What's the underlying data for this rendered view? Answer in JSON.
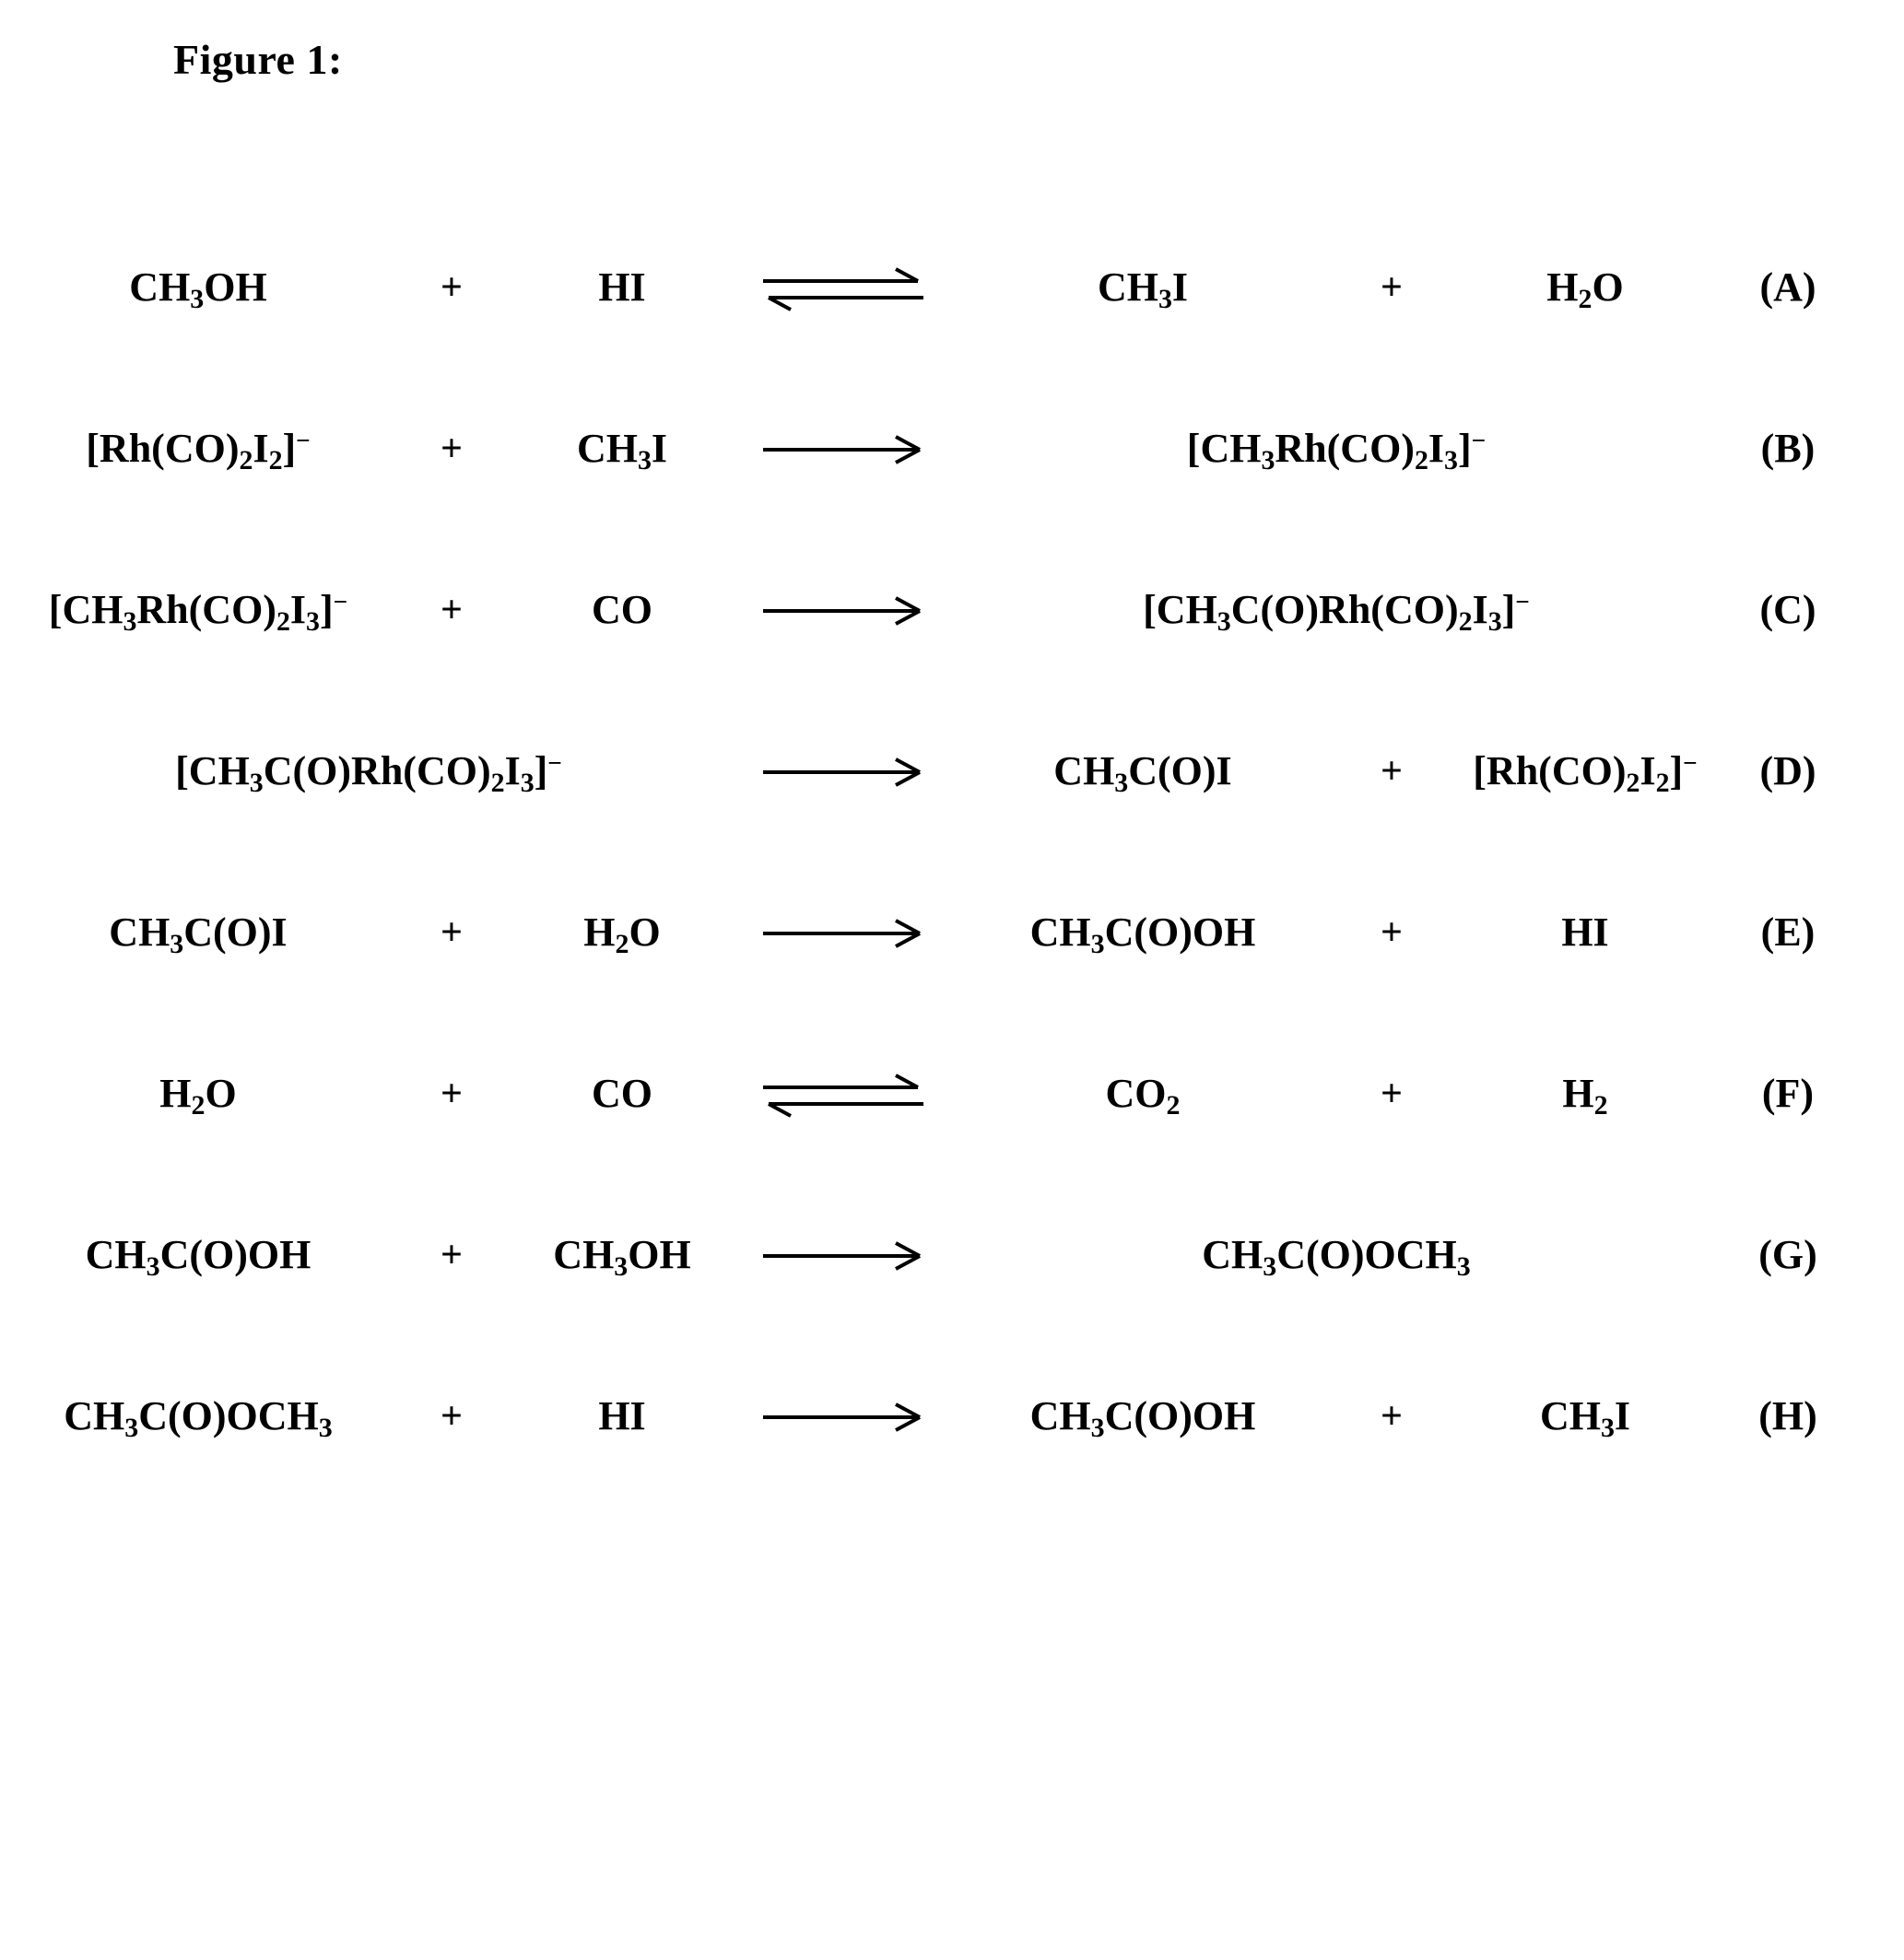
{
  "figure": {
    "caption": "Figure 1:"
  },
  "symbols": {
    "plus": "+",
    "arrow_forward": "forward-arrow",
    "arrow_equilibrium": "equilibrium-arrow"
  },
  "reactions": [
    {
      "id": "A",
      "label": "(A)",
      "arrow": "equilibrium",
      "reactant1": "CH3OH",
      "plus1": "+",
      "reactant2": "HI",
      "product1": "CH3I",
      "plus2": "+",
      "product2": "H2O",
      "text": "CH3OH + HI ⇌ CH3I + H2O"
    },
    {
      "id": "B",
      "label": "(B)",
      "arrow": "forward",
      "reactant1": "[Rh(CO)2I2]-",
      "plus1": "+",
      "reactant2": "CH3I",
      "product1": "[CH3Rh(CO)2I3]-",
      "plus2": "",
      "product2": "",
      "text": "[Rh(CO)2I2]- + CH3I → [CH3Rh(CO)2I3]-"
    },
    {
      "id": "C",
      "label": "(C)",
      "arrow": "forward",
      "reactant1": "[CH3Rh(CO)2I3]-",
      "plus1": "+",
      "reactant2": "CO",
      "product1": "[CH3C(O)Rh(CO)2I3]-",
      "plus2": "",
      "product2": "",
      "text": "[CH3Rh(CO)2I3]- + CO → [CH3C(O)Rh(CO)2I3]-"
    },
    {
      "id": "D",
      "label": "(D)",
      "arrow": "forward",
      "reactant1": "[CH3C(O)Rh(CO)2I3]-",
      "plus1": "",
      "reactant2": "",
      "product1": "CH3C(O)I",
      "plus2": "+",
      "product2": "[Rh(CO)2I2]-",
      "text": "[CH3C(O)Rh(CO)2I3]- → CH3C(O)I + [Rh(CO)2I2]-"
    },
    {
      "id": "E",
      "label": "(E)",
      "arrow": "forward",
      "reactant1": "CH3C(O)I",
      "plus1": "+",
      "reactant2": "H2O",
      "product1": "CH3C(O)OH",
      "plus2": "+",
      "product2": "HI",
      "text": "CH3C(O)I + H2O → CH3C(O)OH + HI"
    },
    {
      "id": "F",
      "label": "(F)",
      "arrow": "equilibrium",
      "reactant1": "H2O",
      "plus1": "+",
      "reactant2": "CO",
      "product1": "CO2",
      "plus2": "+",
      "product2": "H2",
      "text": "H2O + CO ⇌ CO2 + H2"
    },
    {
      "id": "G",
      "label": "(G)",
      "arrow": "forward",
      "reactant1": "CH3C(O)OH",
      "plus1": "+",
      "reactant2": "CH3OH",
      "product1": "CH3C(O)OCH3",
      "plus2": "",
      "product2": "",
      "text": "CH3C(O)OH + CH3OH → CH3C(O)OCH3"
    },
    {
      "id": "H",
      "label": "(H)",
      "arrow": "forward",
      "reactant1": "CH3C(O)OCH3",
      "plus1": "+",
      "reactant2": "HI",
      "product1": "CH3C(O)OH",
      "plus2": "+",
      "product2": "CH3I",
      "text": "CH3C(O)OCH3 + HI → CH3C(O)OH + CH3I"
    }
  ],
  "colors": {
    "ink": "#000000",
    "page": "#ffffff"
  }
}
